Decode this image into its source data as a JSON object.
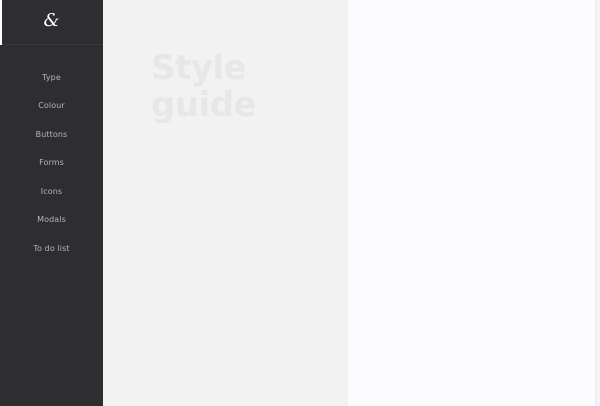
{
  "sidebar": {
    "logo_glyph": "&",
    "items": [
      {
        "label": "Type"
      },
      {
        "label": "Colour"
      },
      {
        "label": "Buttons"
      },
      {
        "label": "Forms"
      },
      {
        "label": "Icons"
      },
      {
        "label": "Modals"
      },
      {
        "label": "To do list"
      }
    ]
  },
  "main": {
    "title": "Style\nguide"
  },
  "colors": {
    "sidebar_bg": "#2e2d30",
    "content_bg": "#f2f2f3",
    "panel_bg": "#fcfbfd",
    "nav_text": "#b5b4b8",
    "title_text": "#e7e7e8"
  }
}
